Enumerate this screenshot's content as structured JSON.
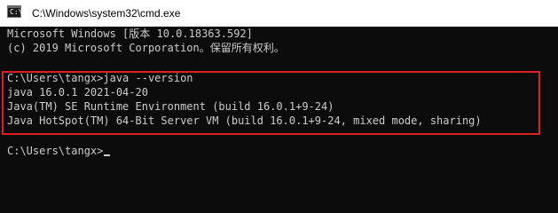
{
  "window": {
    "title": "C:\\Windows\\system32\\cmd.exe",
    "icon": "cmd-icon"
  },
  "console": {
    "banner_line1": "Microsoft Windows [版本 10.0.18363.592]",
    "banner_line2": "(c) 2019 Microsoft Corporation。保留所有权利。",
    "command_line": "C:\\Users\\tangx>java --version",
    "output": [
      "java 16.0.1 2021-04-20",
      "Java(TM) SE Runtime Environment (build 16.0.1+9-24)",
      "Java HotSpot(TM) 64-Bit Server VM (build 16.0.1+9-24, mixed mode, sharing)"
    ],
    "prompt": "C:\\Users\\tangx>"
  },
  "colors": {
    "background": "#0c0c0c",
    "text": "#cccccc",
    "highlight_border": "#e02020"
  }
}
